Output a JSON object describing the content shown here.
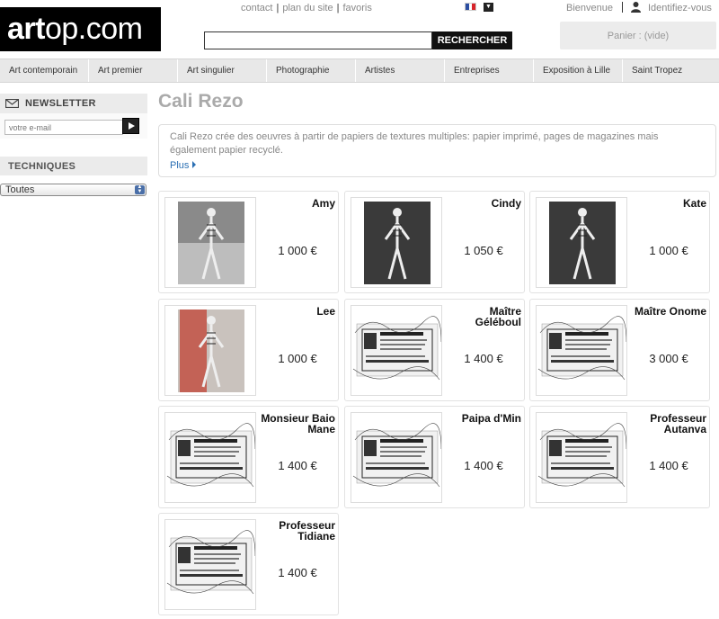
{
  "header": {
    "logo_bold": "art",
    "logo_rest": "op.com",
    "links": [
      "contact",
      "plan du site",
      "favoris"
    ],
    "welcome": "Bienvenue",
    "login": "Identifiez-vous",
    "search_button": "RECHERCHER",
    "cart": "Panier : (vide)"
  },
  "nav": [
    "Art contemporain",
    "Art premier",
    "Art singulier",
    "Photographie",
    "Artistes",
    "Entreprises",
    "Exposition à Lille",
    "Saint Tropez"
  ],
  "sidebar": {
    "newsletter_title": "NEWSLETTER",
    "email_placeholder": "votre e-mail",
    "techniques_title": "TECHNIQUES",
    "techniques_selected": "Toutes"
  },
  "main": {
    "title": "Cali Rezo",
    "description": "Cali Rezo crée des oeuvres à partir de papiers de textures multiples: papier imprimé, pages de magazines mais également papier recyclé.",
    "more": "Plus"
  },
  "products": [
    {
      "title": "Amy",
      "price": "1 000 €",
      "thumb": "figure-beach"
    },
    {
      "title": "Cindy",
      "price": "1 050 €",
      "thumb": "figure-dark"
    },
    {
      "title": "Kate",
      "price": "1 000 €",
      "thumb": "figure-dark"
    },
    {
      "title": "Lee",
      "price": "1 000 €",
      "thumb": "figure-red"
    },
    {
      "title": "Maître Géléboul",
      "price": "1 400 €",
      "thumb": "card-flyer"
    },
    {
      "title": "Maître Onome",
      "price": "3 000 €",
      "thumb": "card-flyer"
    },
    {
      "title": "Monsieur Baio Mane",
      "price": "1 400 €",
      "thumb": "card-flyer"
    },
    {
      "title": "Paipa d'Min",
      "price": "1 400 €",
      "thumb": "card-flyer"
    },
    {
      "title": "Professeur Autanva",
      "price": "1 400 €",
      "thumb": "card-flyer"
    },
    {
      "title": "Professeur Tidiane",
      "price": "1 400 €",
      "thumb": "card-flyer"
    }
  ],
  "colors": {
    "logo_bg": "#000000",
    "nav_bg": "#e8e8e8",
    "link_blue": "#2a6fb3",
    "title_gray": "#aaaaaa",
    "flag_blue": "#2b4ea2",
    "flag_red": "#d8232a"
  }
}
